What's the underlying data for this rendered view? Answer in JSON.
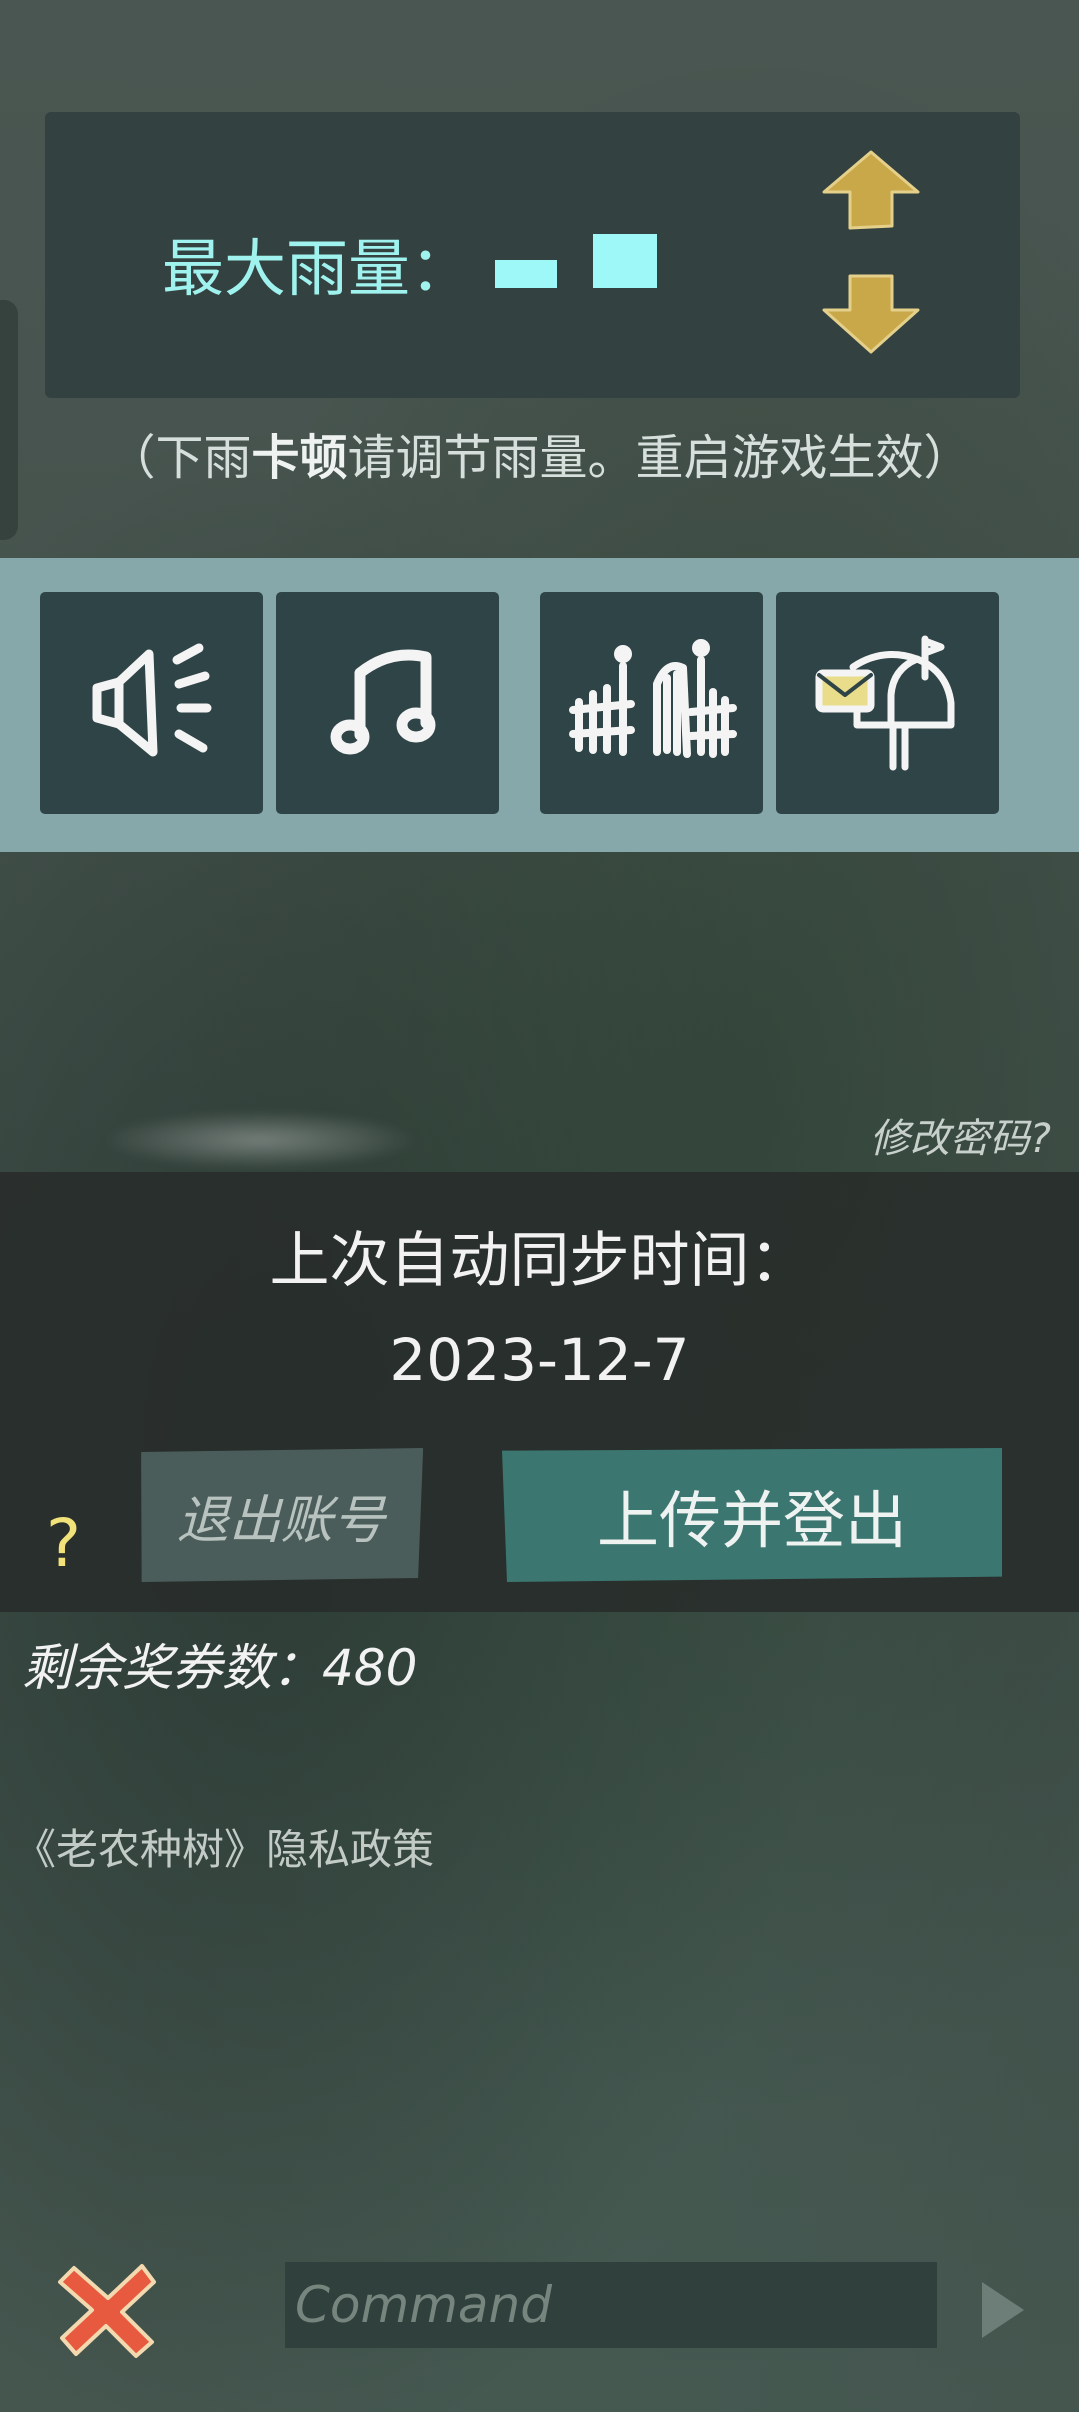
{
  "rain": {
    "label": "最大雨量：",
    "level": 2,
    "max_level": 3,
    "note_before": "（下雨",
    "note_bold": "卡顿",
    "note_after": "请调节雨量。重启游戏生效）"
  },
  "toolbar": {
    "items": [
      {
        "icon": "speaker-icon"
      },
      {
        "icon": "music-note-icon"
      },
      {
        "icon": "fence-gate-icon"
      },
      {
        "icon": "mailbox-icon"
      }
    ]
  },
  "account": {
    "change_password": "修改密码?",
    "sync_title": "上次自动同步时间：",
    "sync_date": "2023-12-7",
    "help": "?",
    "logout_label": "退出账号",
    "upload_logout_label": "上传并登出"
  },
  "vouchers": {
    "label": "剩余奖券数：",
    "count": "480"
  },
  "privacy": "《老农种树》隐私政策",
  "command": {
    "placeholder": "Command",
    "value": ""
  },
  "colors": {
    "accent_cyan": "#9ff8f8",
    "arrow_gold": "#c9a84a",
    "upload_teal": "#3c7670",
    "toolbar_bg": "#86a8ab",
    "close_red": "#e85a3f"
  }
}
